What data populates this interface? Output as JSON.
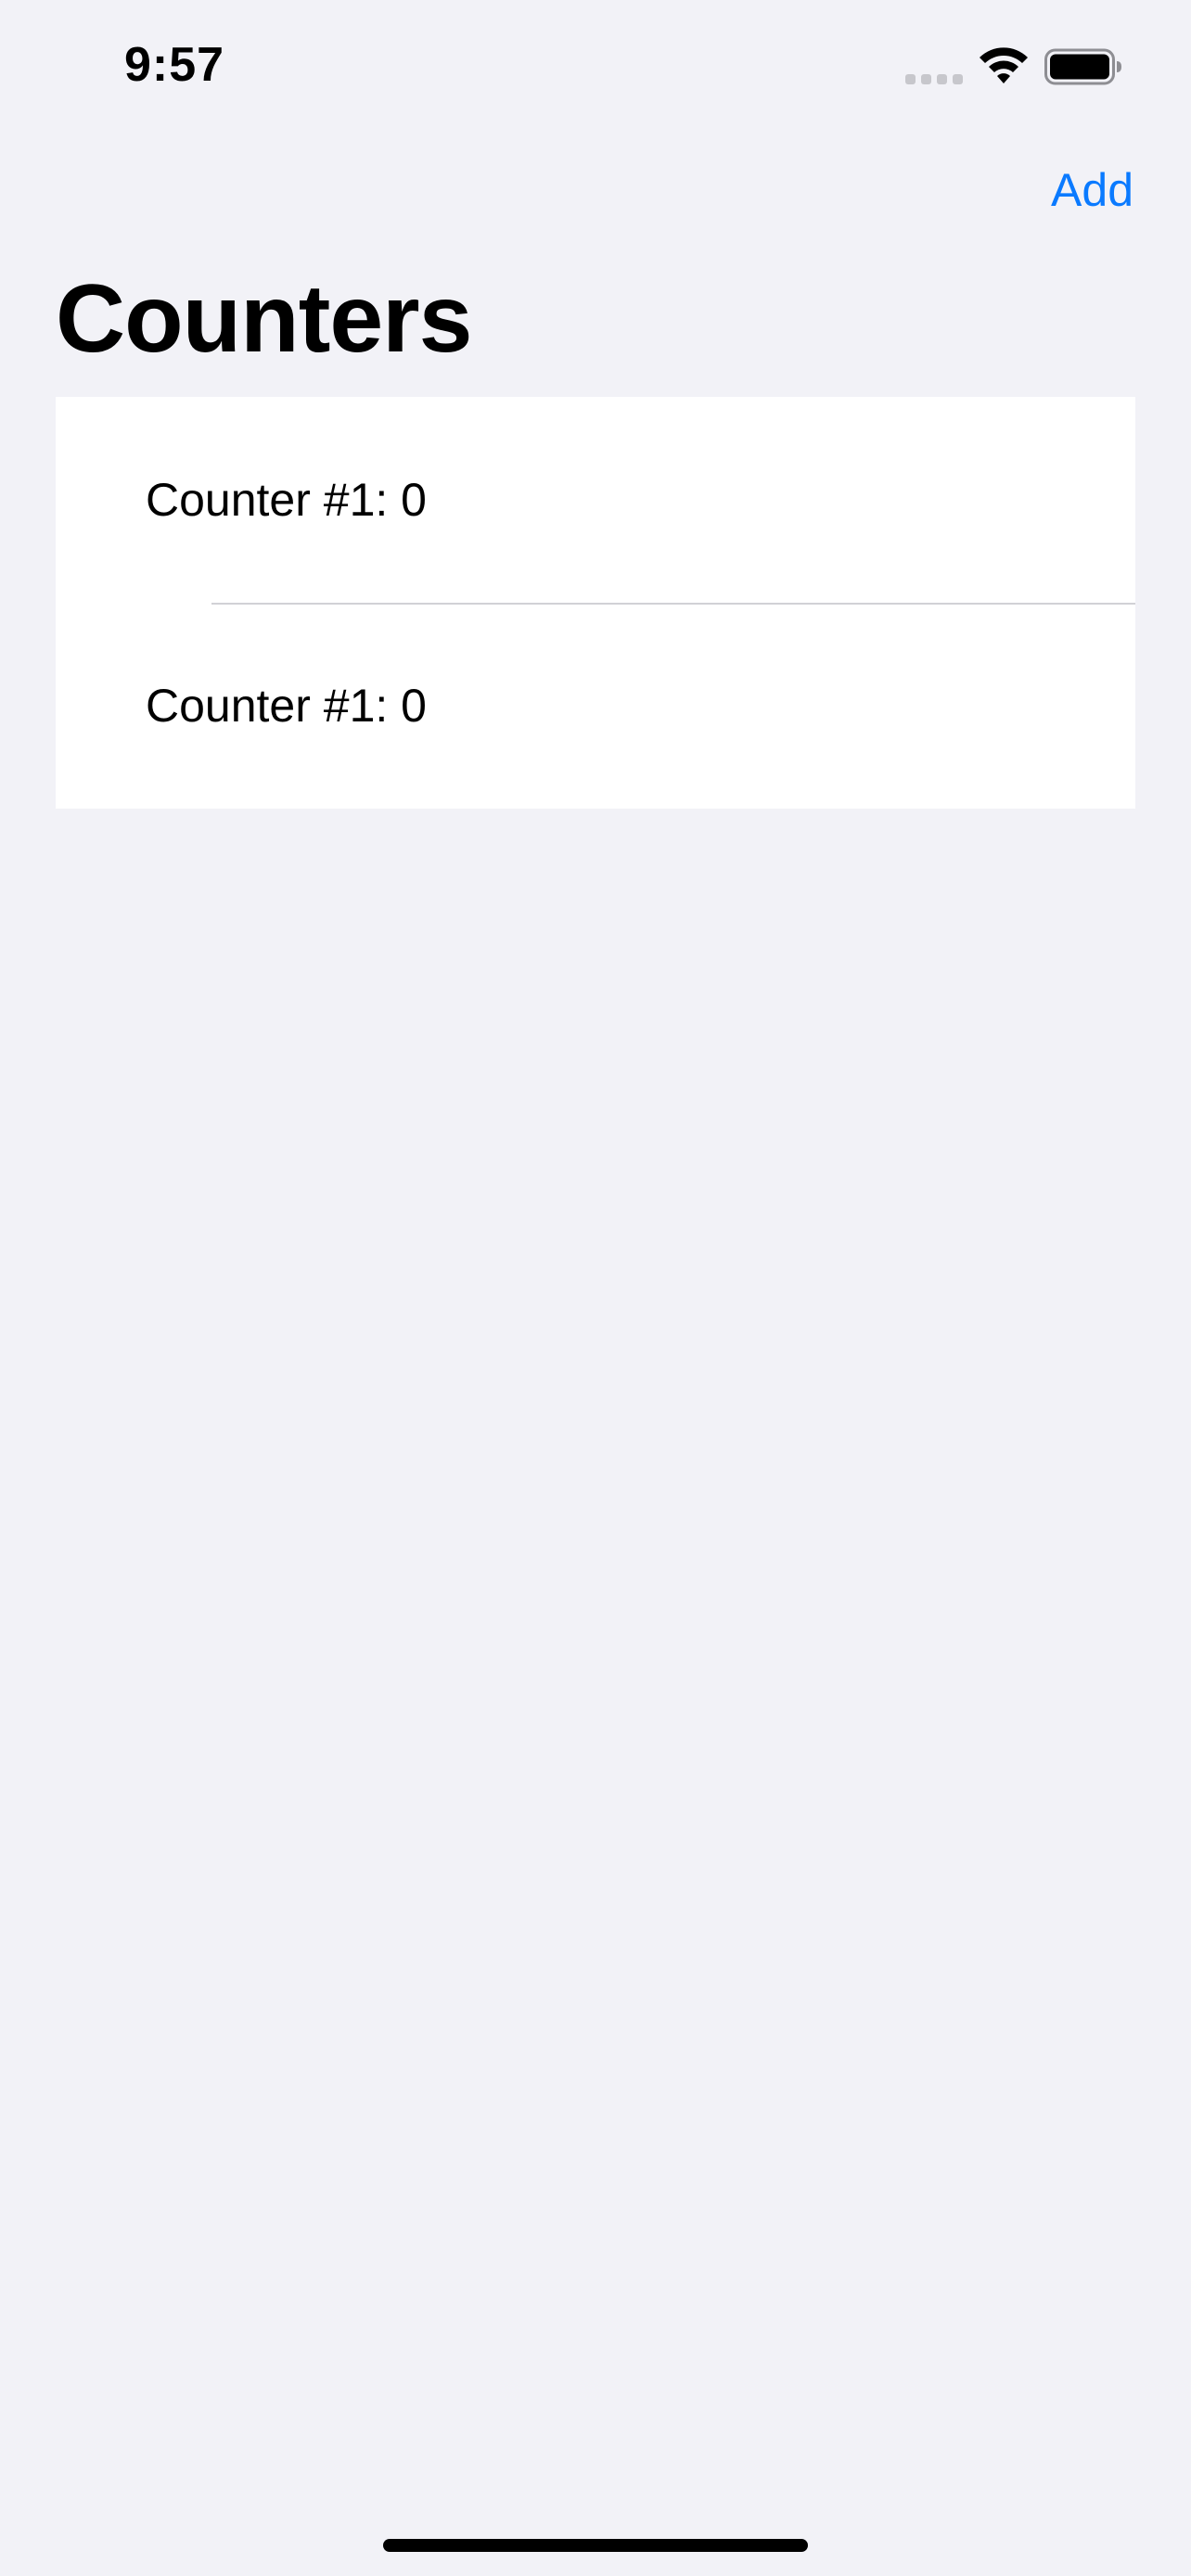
{
  "status_bar": {
    "time": "9:57"
  },
  "nav": {
    "add_label": "Add",
    "title": "Counters",
    "accent_color": "#0a7aff"
  },
  "counters": [
    {
      "label": "Counter #1: 0"
    },
    {
      "label": "Counter #1: 0"
    }
  ],
  "icons": {
    "signal": "cellular-signal-icon",
    "wifi": "wifi-icon",
    "battery": "battery-icon"
  }
}
